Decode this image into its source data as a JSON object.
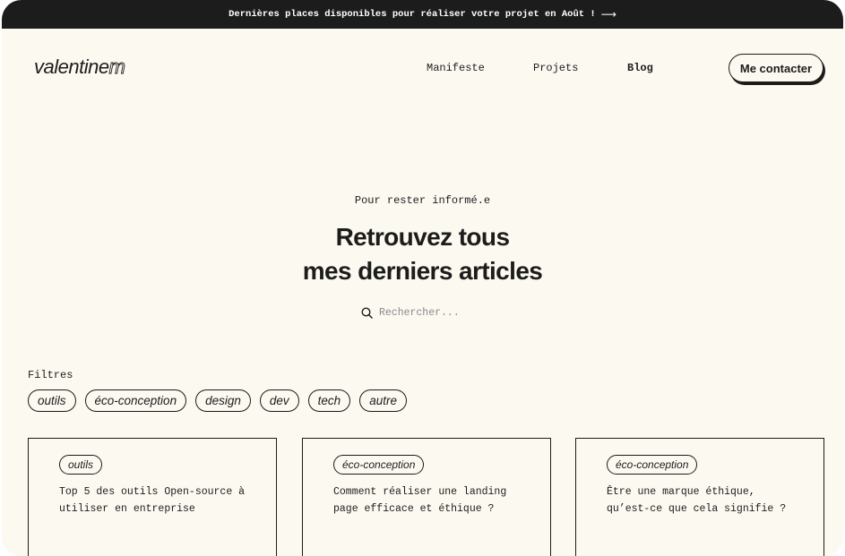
{
  "banner": {
    "text": "Dernières places disponibles pour réaliser votre projet en Août !",
    "arrow": "⟶"
  },
  "logo": {
    "name": "valentine",
    "mark": "m"
  },
  "nav": {
    "items": [
      {
        "label": "Manifeste"
      },
      {
        "label": "Projets"
      },
      {
        "label": "Blog",
        "active": true
      }
    ],
    "contact_label": "Me contacter"
  },
  "hero": {
    "eyebrow": "Pour rester informé.e",
    "title_line1": "Retrouvez tous",
    "title_line2": "mes derniers articles",
    "search_placeholder": "Rechercher...",
    "search_icon": "search-icon"
  },
  "filters": {
    "label": "Filtres",
    "chips": [
      "outils",
      "éco-conception",
      "design",
      "dev",
      "tech",
      "autre"
    ]
  },
  "articles": [
    {
      "tag": "outils",
      "title": "Top 5 des outils Open-source à utiliser en entreprise"
    },
    {
      "tag": "éco-conception",
      "title": "Comment réaliser une landing page efficace et éthique ?"
    },
    {
      "tag": "éco-conception",
      "title": "Être une marque éthique, qu’est-ce que cela signifie ?"
    }
  ],
  "colors": {
    "background": "#fcf9f1",
    "ink": "#1c1c1c",
    "banner": "#1c1c1c"
  }
}
